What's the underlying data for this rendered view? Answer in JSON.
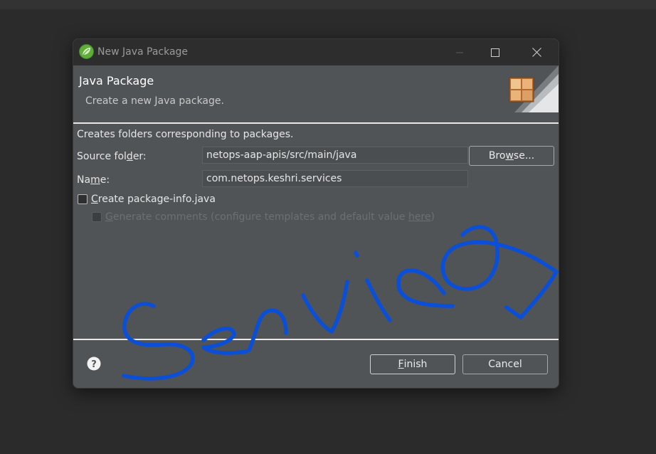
{
  "window": {
    "title": "New Java Package"
  },
  "banner": {
    "title": "Java Package",
    "description": "Create a new Java package."
  },
  "form": {
    "intro": "Creates folders corresponding to packages.",
    "source_folder": {
      "label_pre": "Source fol",
      "label_key": "d",
      "label_post": "er:",
      "value": "netops-aap-apis/src/main/java"
    },
    "browse_button": {
      "key": "w",
      "pre": "Bro",
      "post": "se..."
    },
    "name": {
      "label_pre": "Na",
      "label_key": "m",
      "label_post": "e:",
      "value": "com.netops.keshri.services"
    },
    "create_package_info": {
      "key": "C",
      "rest": "reate package-info.java",
      "checked": false
    },
    "generate_comments": {
      "key": "G",
      "rest": "enerate comments (configure templates and default value ",
      "link": "here",
      "close": ")",
      "checked": false,
      "enabled": false
    }
  },
  "footer": {
    "finish": {
      "key": "F",
      "rest": "inish"
    },
    "cancel": "Cancel"
  },
  "annotation": {
    "color": "#0a4fd6"
  },
  "colors": {
    "dialog_bg": "#505457",
    "titlebar_bg": "#2d2d2d",
    "desktop_bg": "#2b2b2b",
    "ink": "#0a4fd6"
  }
}
